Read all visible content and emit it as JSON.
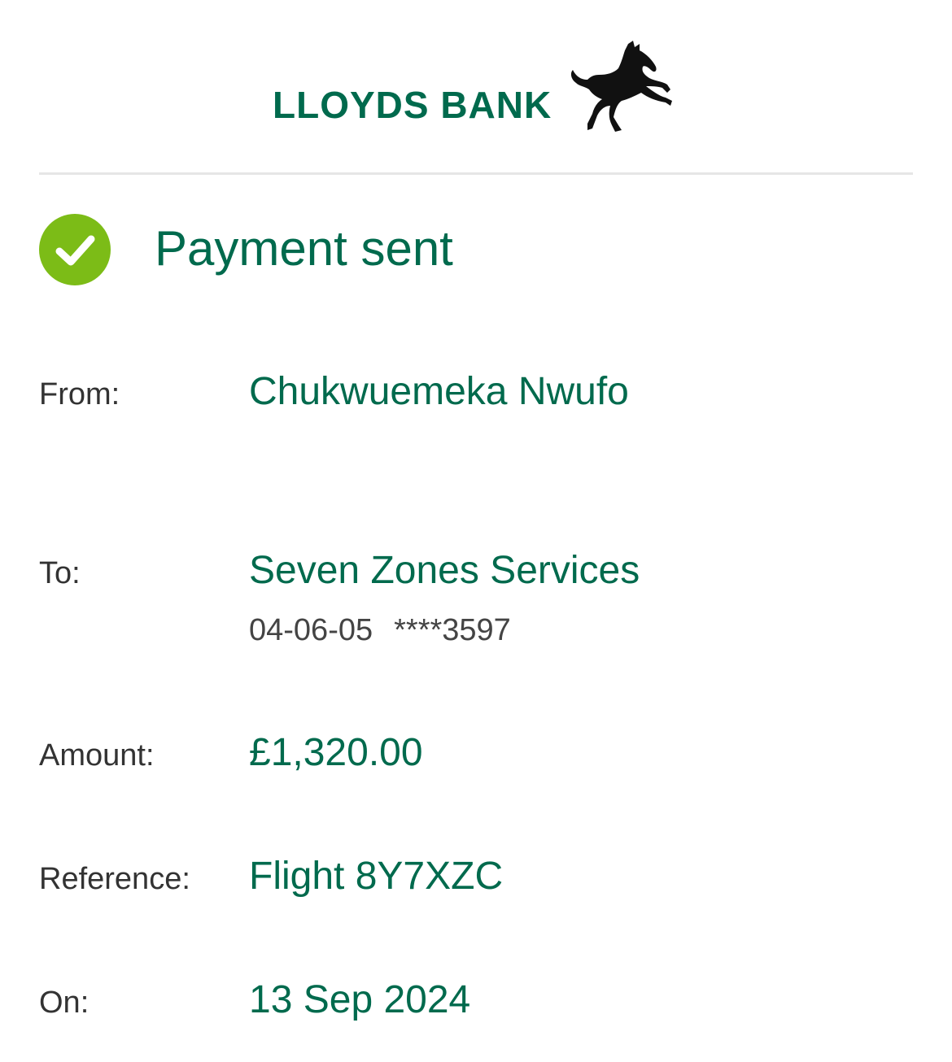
{
  "brand": {
    "name": "LLOYDS BANK",
    "color": "#006a4d",
    "logo_icon": "black-horse-icon"
  },
  "status": {
    "icon": "check-circle-icon",
    "icon_color": "#7cbc17",
    "title": "Payment sent"
  },
  "details": {
    "from": {
      "label": "From:",
      "value": "Chukwuemeka Nwufo"
    },
    "to": {
      "label": "To:",
      "value": "Seven Zones Services",
      "sort_code": "04-06-05",
      "account_number": "****3597"
    },
    "amount": {
      "label": "Amount:",
      "value": "£1,320.00"
    },
    "reference": {
      "label": "Reference:",
      "value": "Flight 8Y7XZC"
    },
    "on": {
      "label": "On:",
      "value": "13 Sep 2024"
    }
  }
}
